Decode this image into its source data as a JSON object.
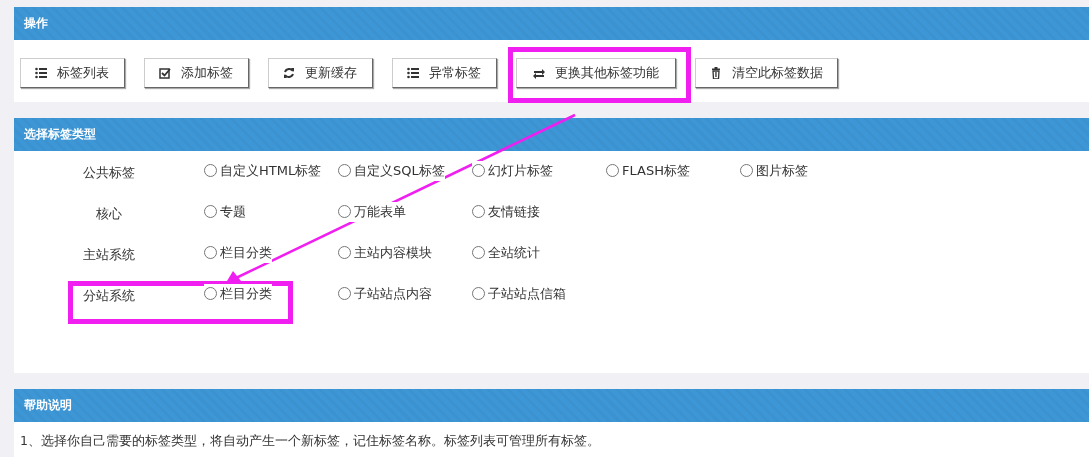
{
  "panels": [
    {
      "kind": "actions",
      "title": "操作",
      "buttons": [
        {
          "label": "标签列表"
        },
        {
          "label": "添加标签"
        },
        {
          "label": "更新缓存"
        },
        {
          "label": "异常标签"
        },
        {
          "label": "更换其他标签功能"
        },
        {
          "label": "清空此标签数据"
        }
      ]
    },
    {
      "kind": "types",
      "title": "选择标签类型",
      "groups": [
        {
          "label": "公共标签",
          "options": [
            {
              "label": "自定义HTML标签",
              "selected": false
            },
            {
              "label": "自定义SQL标签",
              "selected": false
            },
            {
              "label": "幻灯片标签",
              "selected": false
            },
            {
              "label": "FLASH标签",
              "selected": false
            },
            {
              "label": "图片标签",
              "selected": false
            }
          ]
        },
        {
          "label": "核心",
          "options": [
            {
              "label": "专题",
              "selected": false
            },
            {
              "label": "万能表单",
              "selected": false
            },
            {
              "label": "友情链接",
              "selected": false
            }
          ]
        },
        {
          "label": "主站系统",
          "options": [
            {
              "label": "栏目分类",
              "selected": false
            },
            {
              "label": "主站内容模块",
              "selected": false
            },
            {
              "label": "全站统计",
              "selected": false
            }
          ]
        },
        {
          "label": "分站系统",
          "options": [
            {
              "label": "栏目分类",
              "selected": false
            },
            {
              "label": "子站站点内容",
              "selected": false
            },
            {
              "label": "子站站点信箱",
              "selected": false
            }
          ]
        }
      ]
    },
    {
      "kind": "help",
      "title": "帮助说明",
      "lines": [
        "1、选择你自己需要的标签类型，将自动产生一个新标签，记住标签名称。标签列表可管理所有标签。"
      ]
    }
  ]
}
